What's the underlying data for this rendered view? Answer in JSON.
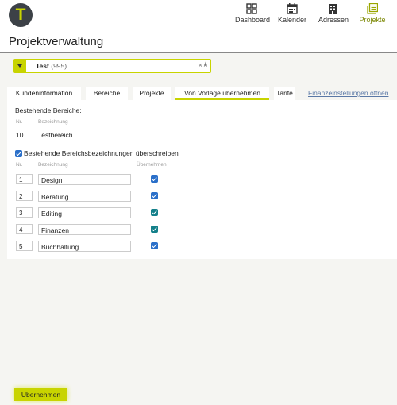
{
  "app": {
    "logo_letter": "T",
    "title": "Projektverwaltung"
  },
  "nav": [
    {
      "label": "Dashboard",
      "icon": "dashboard-icon",
      "active": false
    },
    {
      "label": "Kalender",
      "icon": "calendar-icon",
      "active": false
    },
    {
      "label": "Adressen",
      "icon": "building-icon",
      "active": false
    },
    {
      "label": "Projekte",
      "icon": "projects-icon",
      "active": true
    }
  ],
  "project_select": {
    "name": "Test",
    "id": "(995)",
    "clear": "×",
    "favorite": "★"
  },
  "tabs": [
    {
      "label": "Kundeninformation",
      "active": false
    },
    {
      "label": "Bereiche",
      "active": false
    },
    {
      "label": "Projekte",
      "active": false
    },
    {
      "label": "Von Vorlage übernehmen",
      "active": true
    },
    {
      "label": "Tarife",
      "active": false
    },
    {
      "label": "Finanzeinstellungen öffnen",
      "active": false,
      "link": true
    }
  ],
  "existing": {
    "heading": "Bestehende Bereiche:",
    "col_nr": "Nr.",
    "col_name": "Bezeichnung",
    "rows": [
      {
        "nr": "10",
        "name": "Testbereich"
      }
    ]
  },
  "overwrite": {
    "label": "Bestehende Bereichsbezeichnungen überschreiben",
    "checked": true
  },
  "template": {
    "col_nr": "Nr.",
    "col_name": "Bezeichnung",
    "col_apply": "Übernehmen",
    "rows": [
      {
        "nr": "1",
        "name": "Design",
        "apply": true
      },
      {
        "nr": "2",
        "name": "Beratung",
        "apply": true
      },
      {
        "nr": "3",
        "name": "Editing",
        "apply": true
      },
      {
        "nr": "4",
        "name": "Finanzen",
        "apply": true
      },
      {
        "nr": "5",
        "name": "Buchhaltung",
        "apply": true
      }
    ]
  },
  "footer": {
    "apply_label": "Übernehmen"
  },
  "colors": {
    "accent": "#c8d400",
    "checkbox": "#2a6fc9",
    "logo_bg": "#3c4147"
  }
}
